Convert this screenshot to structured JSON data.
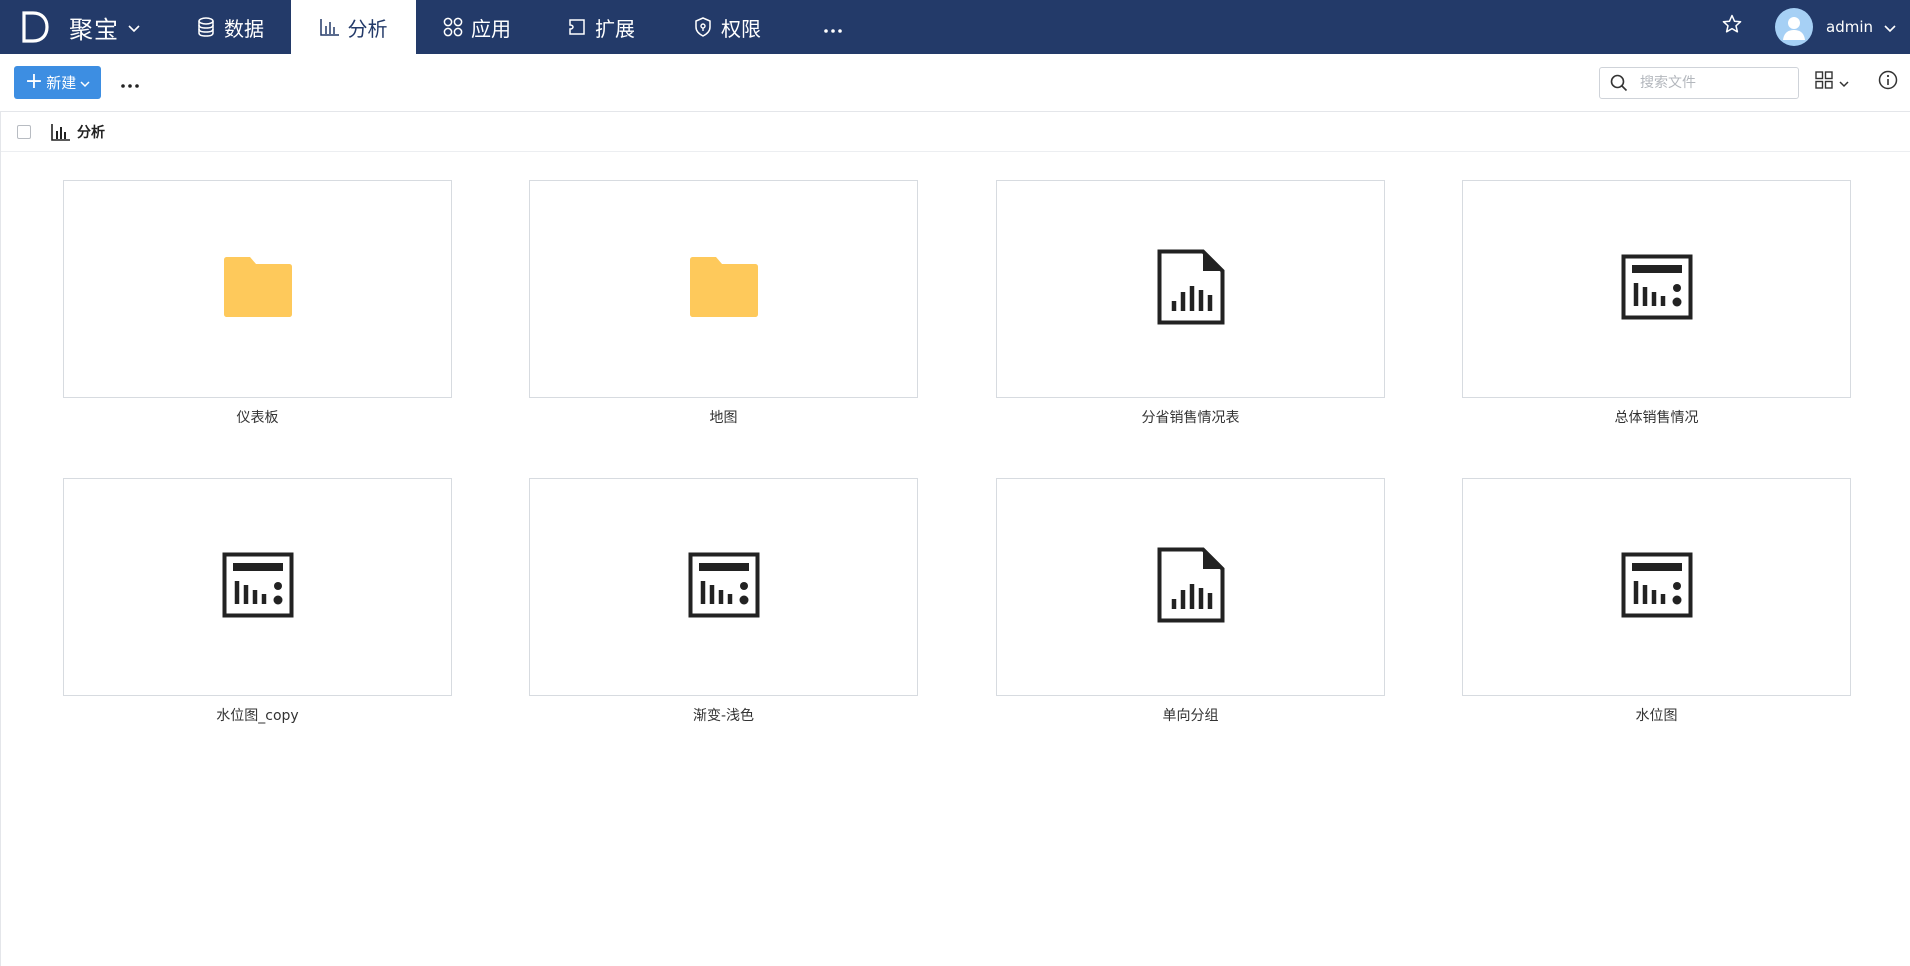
{
  "brand": {
    "letter": "D",
    "name": "聚宝"
  },
  "nav": {
    "tabs": [
      {
        "label": "数据",
        "icon": "database-icon",
        "active": false
      },
      {
        "label": "分析",
        "icon": "bar-chart-icon",
        "active": true
      },
      {
        "label": "应用",
        "icon": "apps-icon",
        "active": false
      },
      {
        "label": "扩展",
        "icon": "puzzle-icon",
        "active": false
      },
      {
        "label": "权限",
        "icon": "shield-icon",
        "active": false
      }
    ]
  },
  "user": {
    "name": "admin"
  },
  "toolbar": {
    "new_label": "新建",
    "search_placeholder": "搜索文件"
  },
  "breadcrumb": {
    "label": "分析"
  },
  "items": [
    {
      "label": "仪表板",
      "type": "folder"
    },
    {
      "label": "地图",
      "type": "folder"
    },
    {
      "label": "分省销售情况表",
      "type": "report"
    },
    {
      "label": "总体销售情况",
      "type": "dashboard"
    },
    {
      "label": "水位图_copy",
      "type": "dashboard"
    },
    {
      "label": "渐变-浅色",
      "type": "dashboard"
    },
    {
      "label": "单向分组",
      "type": "report"
    },
    {
      "label": "水位图",
      "type": "dashboard"
    }
  ],
  "colors": {
    "topbar": "#233a69",
    "accent": "#3d8ee2",
    "folder": "#fec95b",
    "avatar": "#a6d0f5"
  }
}
